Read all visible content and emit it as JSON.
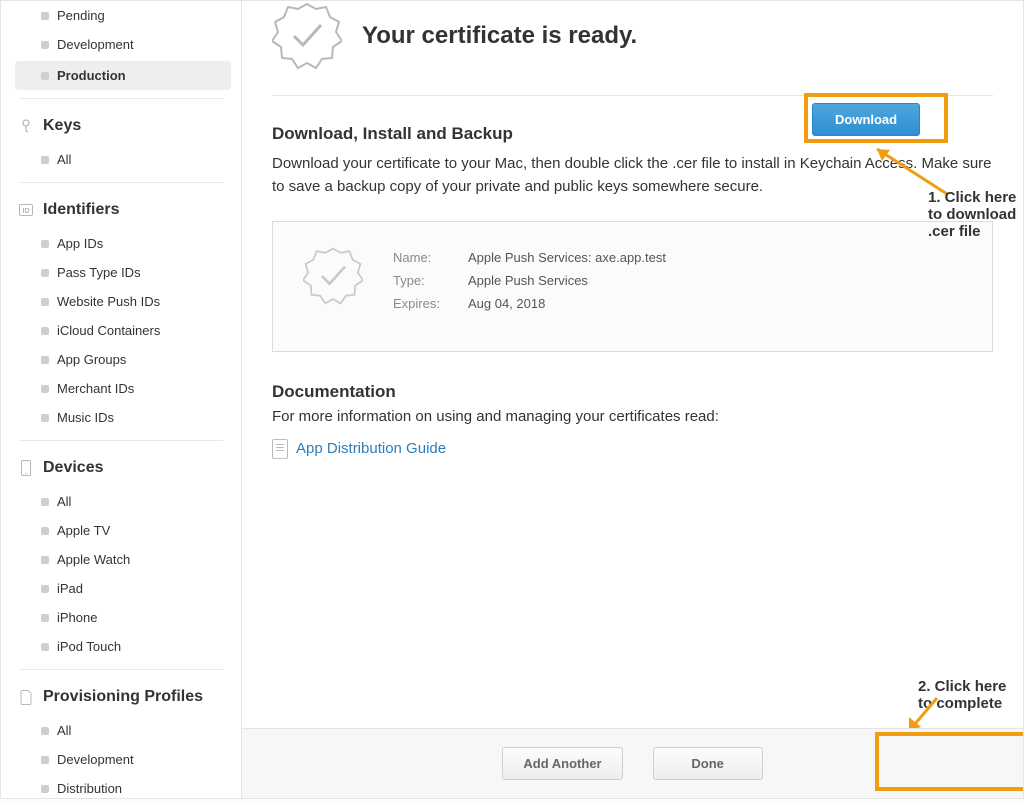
{
  "sidebar": {
    "certificates_top": [
      {
        "label": "Pending"
      },
      {
        "label": "Development"
      },
      {
        "label": "Production",
        "active": true
      }
    ],
    "keys": {
      "header": "Keys",
      "items": [
        {
          "label": "All"
        }
      ]
    },
    "identifiers": {
      "header": "Identifiers",
      "items": [
        {
          "label": "App IDs"
        },
        {
          "label": "Pass Type IDs"
        },
        {
          "label": "Website Push IDs"
        },
        {
          "label": "iCloud Containers"
        },
        {
          "label": "App Groups"
        },
        {
          "label": "Merchant IDs"
        },
        {
          "label": "Music IDs"
        }
      ]
    },
    "devices": {
      "header": "Devices",
      "items": [
        {
          "label": "All"
        },
        {
          "label": "Apple TV"
        },
        {
          "label": "Apple Watch"
        },
        {
          "label": "iPad"
        },
        {
          "label": "iPhone"
        },
        {
          "label": "iPod Touch"
        }
      ]
    },
    "profiles": {
      "header": "Provisioning Profiles",
      "items": [
        {
          "label": "All"
        },
        {
          "label": "Development"
        },
        {
          "label": "Distribution"
        }
      ]
    }
  },
  "header": {
    "title": "Your certificate is ready."
  },
  "download": {
    "title": "Download, Install and Backup",
    "desc": "Download your certificate to your Mac, then double click the .cer file to install in Keychain Access. Make sure to save a backup copy of your private and public keys somewhere secure.",
    "name_k": "Name:",
    "name_v": "Apple Push Services: axe.app.test",
    "type_k": "Type:",
    "type_v": "Apple Push Services",
    "exp_k": "Expires:",
    "exp_v": "Aug 04, 2018",
    "btn": "Download"
  },
  "docs": {
    "title": "Documentation",
    "desc": "For more information on using and managing your certificates read:",
    "link": "App Distribution Guide"
  },
  "footer": {
    "add": "Add Another",
    "done": "Done"
  },
  "anno": {
    "a1": "1. Click here to download .cer file",
    "a2": "2. Click here to complete"
  }
}
